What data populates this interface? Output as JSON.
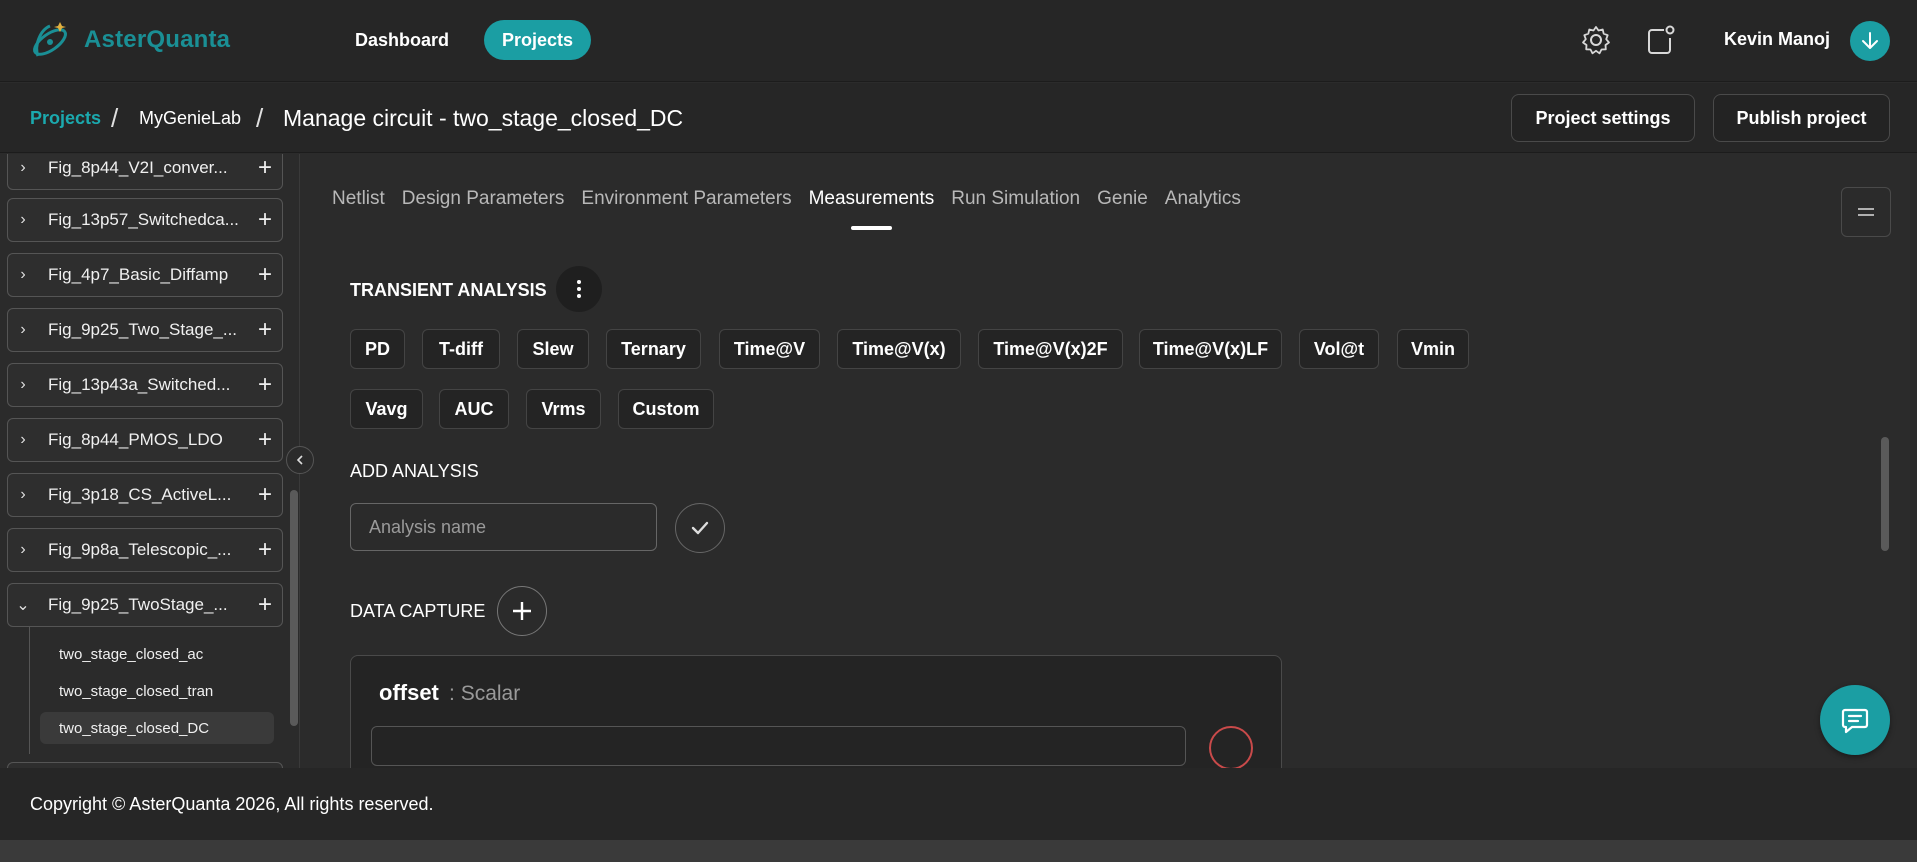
{
  "app": {
    "name": "AsterQuanta"
  },
  "nav": {
    "dashboard": "Dashboard",
    "projects": "Projects"
  },
  "user": {
    "name": "Kevin Manoj"
  },
  "breadcrumb": {
    "projects": "Projects",
    "lab": "MyGenieLab",
    "sep": "/",
    "title": "Manage circuit - two_stage_closed_DC"
  },
  "actions": {
    "project_settings": "Project settings",
    "publish_project": "Publish project"
  },
  "sidebar": {
    "items": [
      {
        "label": "Fig_8p44_V2I_conver...",
        "chevron": "›"
      },
      {
        "label": "Fig_13p57_Switchedca...",
        "chevron": "›"
      },
      {
        "label": "Fig_4p7_Basic_Diffamp",
        "chevron": "›"
      },
      {
        "label": "Fig_9p25_Two_Stage_...",
        "chevron": "›"
      },
      {
        "label": "Fig_13p43a_Switched...",
        "chevron": "›"
      },
      {
        "label": "Fig_8p44_PMOS_LDO",
        "chevron": "›"
      },
      {
        "label": "Fig_3p18_CS_ActiveL...",
        "chevron": "›"
      },
      {
        "label": "Fig_9p8a_Telescopic_...",
        "chevron": "›"
      },
      {
        "label": "Fig_9p25_TwoStage_...",
        "chevron": "⌄"
      }
    ],
    "subitems": [
      "two_stage_closed_ac",
      "two_stage_closed_tran",
      "two_stage_closed_DC"
    ],
    "active_subitem": "two_stage_closed_DC"
  },
  "tabs": [
    "Netlist",
    "Design Parameters",
    "Environment Parameters",
    "Measurements",
    "Run Simulation",
    "Genie",
    "Analytics"
  ],
  "active_tab": "Measurements",
  "transient": {
    "title": "TRANSIENT ANALYSIS",
    "chips": [
      "PD",
      "T-diff",
      "Slew",
      "Ternary",
      "Time@V",
      "Time@V(x)",
      "Time@V(x)2F",
      "Time@V(x)LF",
      "Vol@t",
      "Vmin",
      "Vavg",
      "AUC",
      "Vrms",
      "Custom"
    ]
  },
  "add_analysis": {
    "title": "ADD ANALYSIS",
    "placeholder": "Analysis name"
  },
  "data_capture": {
    "title": "DATA CAPTURE",
    "name": "offset",
    "type_sep": ":",
    "type": "Scalar"
  },
  "footer": {
    "copyright": "Copyright © AsterQuanta 2026, All rights reserved."
  },
  "colors": {
    "accent": "#1b9ea3",
    "brand_text": "#1a8f95",
    "background": "#2b2b2b"
  },
  "icons": [
    "logo-atom-icon",
    "gear-icon",
    "notification-icon",
    "download-arrow-icon",
    "chevron-right-icon",
    "chevron-down-icon",
    "plus-icon",
    "chevron-left-icon",
    "hamburger-icon",
    "kebab-menu-icon",
    "checkmark-icon",
    "chat-icon"
  ]
}
